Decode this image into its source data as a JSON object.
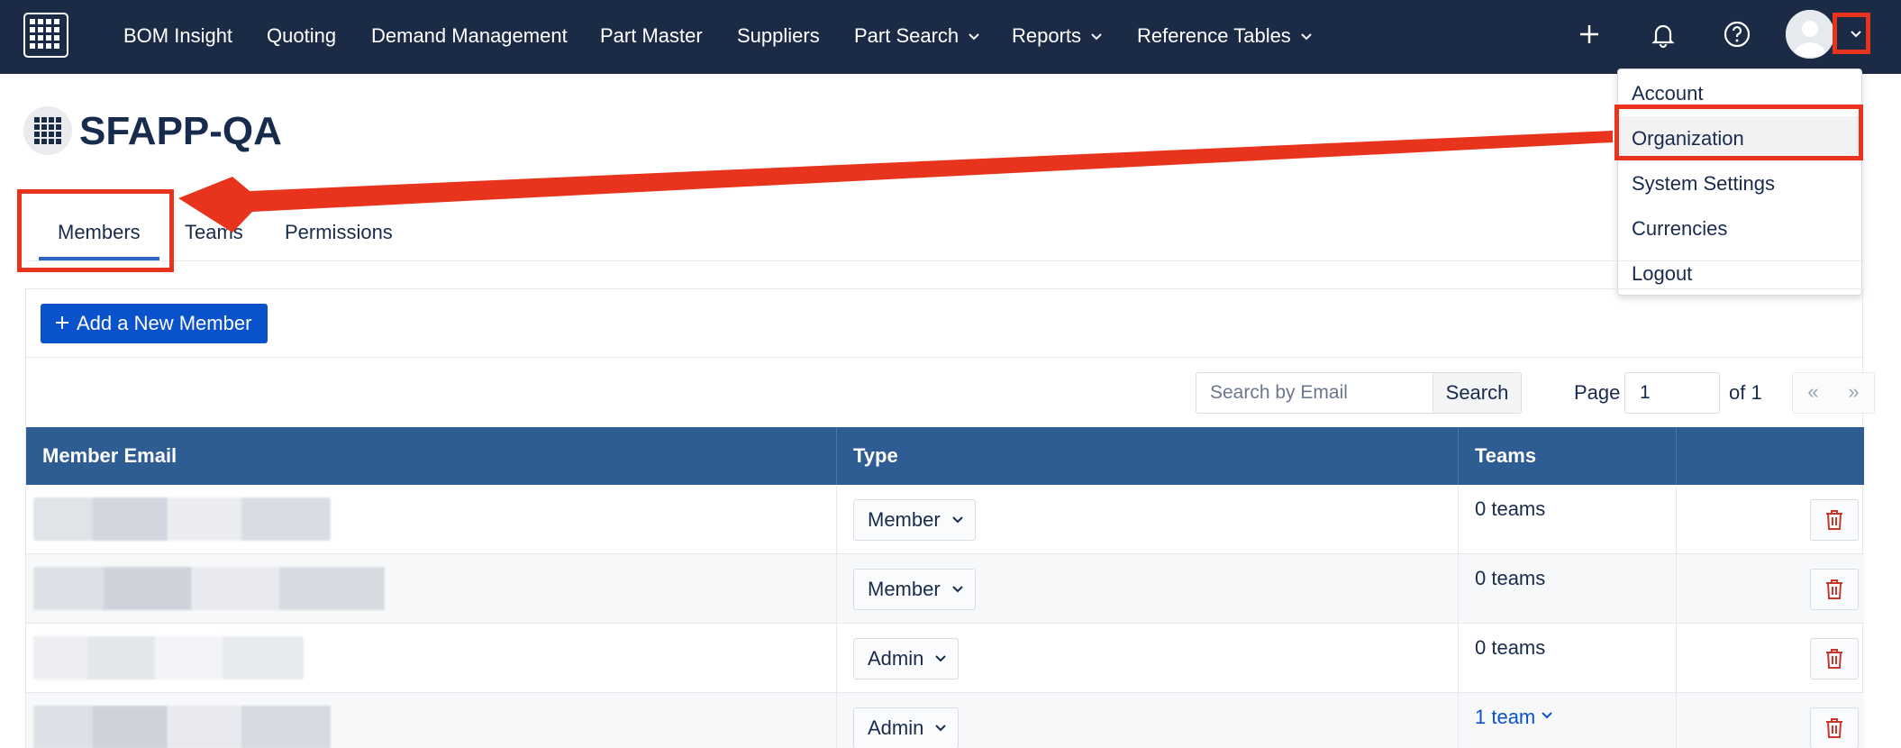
{
  "nav": {
    "items": [
      {
        "label": "BOM Insight"
      },
      {
        "label": "Quoting"
      },
      {
        "label": "Demand Management"
      },
      {
        "label": "Part Master"
      },
      {
        "label": "Suppliers"
      },
      {
        "label": "Part Search"
      },
      {
        "label": "Reports"
      },
      {
        "label": "Reference Tables"
      }
    ],
    "icons": [
      "plus-icon",
      "bell-icon",
      "help-icon",
      "avatar",
      "chevron-down-icon"
    ]
  },
  "user_menu": {
    "items": [
      {
        "label": "Account"
      },
      {
        "label": "Organization"
      },
      {
        "label": "System Settings"
      },
      {
        "label": "Currencies"
      },
      {
        "label": "Logout"
      }
    ],
    "active": "Organization"
  },
  "page": {
    "title": "SFAPP-QA"
  },
  "tabs": [
    {
      "label": "Members"
    },
    {
      "label": "Teams"
    },
    {
      "label": "Permissions"
    }
  ],
  "toolbar": {
    "add_label": "Add a New Member",
    "search_placeholder": "Search by Email",
    "search_label": "Search",
    "page_label": "Page",
    "page_value": "1",
    "of_label": "of 1",
    "prev_label": "«",
    "next_label": "»"
  },
  "table": {
    "columns": [
      "Member Email",
      "Type",
      "Teams",
      ""
    ],
    "rows": [
      {
        "type": "Member",
        "teams": "0 teams"
      },
      {
        "type": "Member",
        "teams": "0 teams"
      },
      {
        "type": "Admin",
        "teams": "0 teams"
      },
      {
        "type": "Admin",
        "teams": "1 team"
      }
    ]
  },
  "colors": {
    "nav_bg": "#1c2b45",
    "table_header": "#2d5d92",
    "primary_button": "#0a52cc",
    "annotation_red": "#e8331d",
    "delete_icon": "#c9372c"
  }
}
